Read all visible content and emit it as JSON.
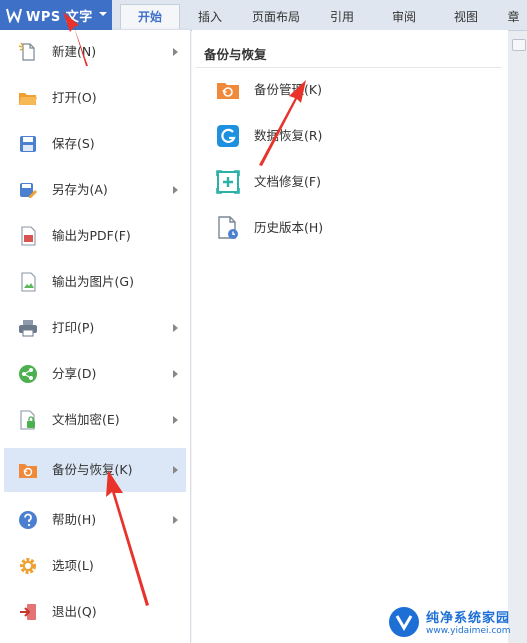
{
  "app": {
    "title": "WPS 文字",
    "logo_icon": "wps-w-logo",
    "accent": "#3f70c8"
  },
  "ribbon": {
    "tabs": [
      {
        "label": "开始",
        "active": true
      },
      {
        "label": "插入",
        "active": false
      },
      {
        "label": "页面布局",
        "active": false
      },
      {
        "label": "引用",
        "active": false
      },
      {
        "label": "审阅",
        "active": false
      },
      {
        "label": "视图",
        "active": false
      },
      {
        "label": "章",
        "active": false
      }
    ]
  },
  "menu": {
    "items": [
      {
        "label": "新建(N)",
        "icon": "new-document-icon",
        "has_submenu": true,
        "selected": false
      },
      {
        "label": "打开(O)",
        "icon": "open-folder-icon",
        "has_submenu": false,
        "selected": false
      },
      {
        "label": "保存(S)",
        "icon": "save-disk-icon",
        "has_submenu": false,
        "selected": false
      },
      {
        "label": "另存为(A)",
        "icon": "save-as-icon",
        "has_submenu": true,
        "selected": false
      },
      {
        "label": "输出为PDF(F)",
        "icon": "export-pdf-icon",
        "has_submenu": false,
        "selected": false
      },
      {
        "label": "输出为图片(G)",
        "icon": "export-image-icon",
        "has_submenu": false,
        "selected": false
      },
      {
        "label": "打印(P)",
        "icon": "printer-icon",
        "has_submenu": true,
        "selected": false
      },
      {
        "label": "分享(D)",
        "icon": "share-icon",
        "has_submenu": true,
        "selected": false
      },
      {
        "label": "文档加密(E)",
        "icon": "document-lock-icon",
        "has_submenu": true,
        "selected": false
      },
      {
        "label": "备份与恢复(K)",
        "icon": "backup-folder-icon",
        "has_submenu": true,
        "selected": true
      },
      {
        "label": "帮助(H)",
        "icon": "help-icon",
        "has_submenu": true,
        "selected": false
      },
      {
        "label": "选项(L)",
        "icon": "gear-icon",
        "has_submenu": false,
        "selected": false
      },
      {
        "label": "退出(Q)",
        "icon": "exit-icon",
        "has_submenu": false,
        "selected": false
      }
    ]
  },
  "panel": {
    "title": "备份与恢复",
    "items": [
      {
        "label": "备份管理(K)",
        "icon": "backup-manage-icon"
      },
      {
        "label": "数据恢复(R)",
        "icon": "data-recovery-icon"
      },
      {
        "label": "文档修复(F)",
        "icon": "document-repair-icon"
      },
      {
        "label": "历史版本(H)",
        "icon": "history-version-icon"
      }
    ]
  },
  "watermark": {
    "line1": "纯净系统家园",
    "line2": "www.yidaimei.com"
  }
}
